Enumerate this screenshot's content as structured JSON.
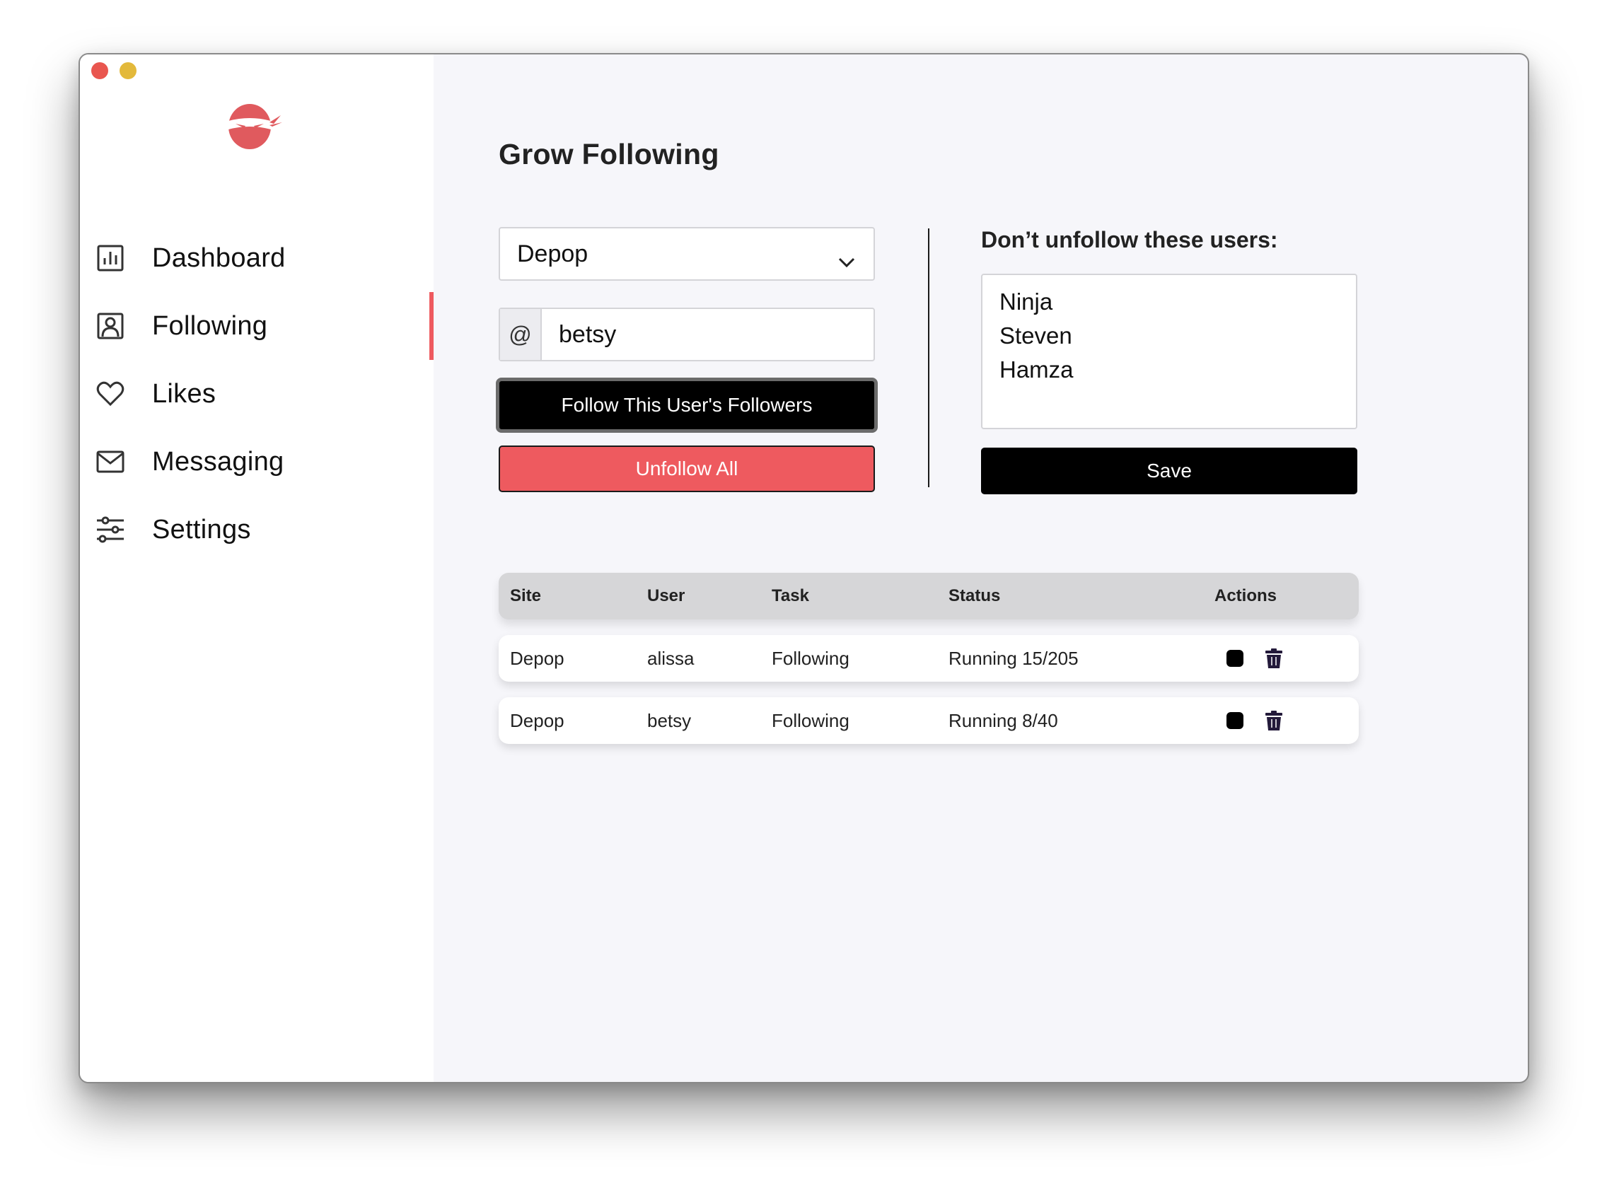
{
  "sidebar": {
    "items": [
      {
        "label": "Dashboard",
        "icon": "bar-chart-icon"
      },
      {
        "label": "Following",
        "icon": "user-card-icon",
        "active": true
      },
      {
        "label": "Likes",
        "icon": "heart-icon"
      },
      {
        "label": "Messaging",
        "icon": "mail-icon"
      },
      {
        "label": "Settings",
        "icon": "sliders-icon"
      }
    ]
  },
  "main": {
    "title": "Grow Following",
    "site_select": {
      "value": "Depop"
    },
    "username": {
      "prefix": "@",
      "value": "betsy"
    },
    "follow_button": "Follow This User's Followers",
    "unfollow_button": "Unfollow All",
    "keep": {
      "label": "Don’t unfollow these users:",
      "users": [
        "Ninja",
        "Steven",
        "Hamza"
      ],
      "save_button": "Save"
    },
    "table": {
      "headers": [
        "Site",
        "User",
        "Task",
        "Status",
        "Actions"
      ],
      "rows": [
        {
          "site": "Depop",
          "user": "alissa",
          "task": "Following",
          "status": "Running 15/205"
        },
        {
          "site": "Depop",
          "user": "betsy",
          "task": "Following",
          "status": "Running 8/40"
        }
      ]
    }
  },
  "colors": {
    "accent": "#ee5a5f",
    "primary_button": "#000000",
    "background": "#f6f6fa",
    "trash_icon": "#231a3a"
  }
}
